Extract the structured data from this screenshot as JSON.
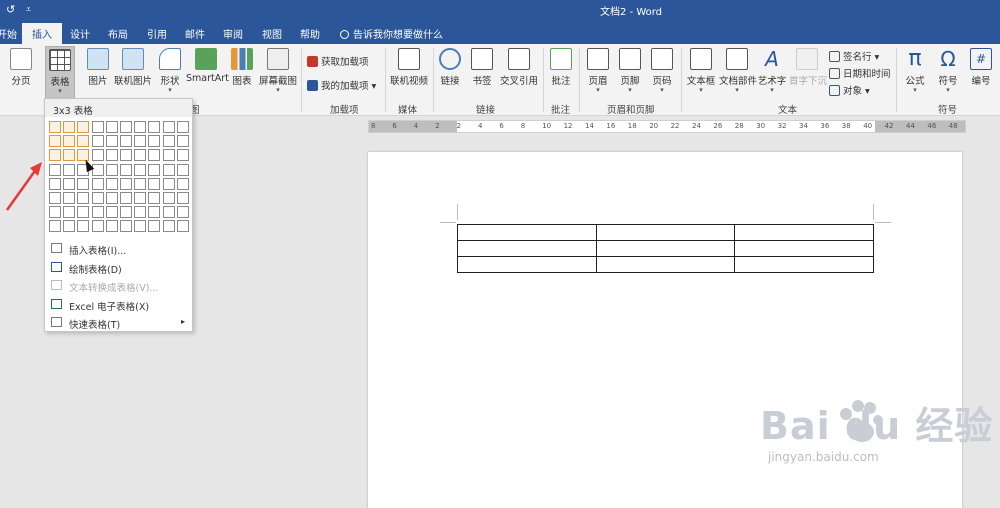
{
  "titlebar": {
    "undo_glyph": "↺",
    "qa_glyph": "⩡",
    "doc_title": "文档2  -  Word"
  },
  "tabs": [
    {
      "label": "开始"
    },
    {
      "label": "插入"
    },
    {
      "label": "设计"
    },
    {
      "label": "布局"
    },
    {
      "label": "引用"
    },
    {
      "label": "邮件"
    },
    {
      "label": "审阅"
    },
    {
      "label": "视图"
    },
    {
      "label": "帮助"
    }
  ],
  "tellme": "告诉我你想要做什么",
  "ribbon": {
    "page_break": "分页",
    "table": "表格",
    "picture": "图片",
    "online_picture": "联机图片",
    "shapes": "形状",
    "smartart": "SmartArt",
    "chart": "图表",
    "screenshot": "屏幕截图",
    "get_addins": "获取加载项",
    "my_addins": "我的加载项",
    "online_video": "联机视频",
    "link": "链接",
    "bookmark": "书签",
    "cross_ref": "交叉引用",
    "comment": "批注",
    "header": "页眉",
    "footer": "页脚",
    "page_number": "页码",
    "textbox": "文本框",
    "quick_parts": "文档部件",
    "wordart": "艺术字",
    "dropcap": "首字下沉",
    "signature": "签名行",
    "datetime": "日期和时间",
    "object": "对象",
    "equation": "公式",
    "symbol": "符号",
    "numbering": "编号",
    "pi_glyph": "π",
    "omega_glyph": "Ω",
    "hash_glyph": "#",
    "groups": {
      "illustrations_tail": "图",
      "addins": "加载项",
      "media": "媒体",
      "links": "链接",
      "comments": "批注",
      "header_footer": "页眉和页脚",
      "text": "文本",
      "symbols": "符号"
    }
  },
  "ruler_ticks": [
    "8",
    "6",
    "4",
    "2",
    "2",
    "4",
    "6",
    "8",
    "10",
    "12",
    "14",
    "16",
    "18",
    "20",
    "22",
    "24",
    "26",
    "28",
    "30",
    "32",
    "34",
    "36",
    "38",
    "40",
    "42",
    "44",
    "46",
    "48"
  ],
  "table_menu": {
    "header": "3x3 表格",
    "grid_cols": 10,
    "grid_rows": 8,
    "selected_cols": 3,
    "selected_rows": 3,
    "items": [
      {
        "label": "插入表格(I)...",
        "disabled": false
      },
      {
        "label": "绘制表格(D)",
        "disabled": false
      },
      {
        "label": "文本转换成表格(V)...",
        "disabled": true
      },
      {
        "label": "Excel 电子表格(X)",
        "disabled": false
      },
      {
        "label": "快速表格(T)",
        "disabled": false,
        "submenu_glyph": "▸"
      }
    ]
  },
  "document": {
    "table_rows": 3,
    "table_cols": 3
  },
  "watermark": {
    "logo": "Bai du 经验",
    "url": "jingyan.baidu.com"
  },
  "colors": {
    "brand": "#2b579a",
    "grid_highlight": "#e8963a",
    "arrow": "#e53935"
  }
}
